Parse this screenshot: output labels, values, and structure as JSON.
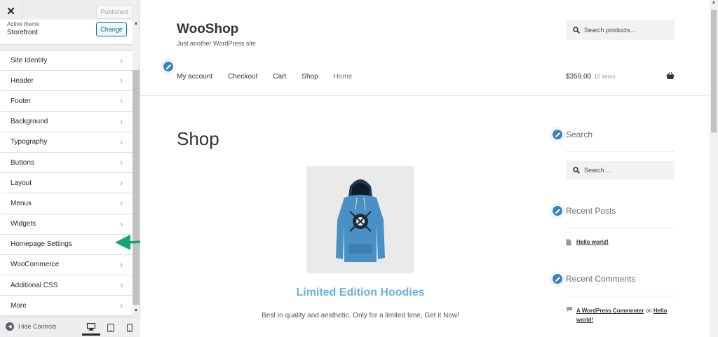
{
  "sidebar": {
    "close_label": "✕",
    "published_label": "Published",
    "theme_caption": "Active theme",
    "theme_name": "Storefront",
    "change_label": "Change",
    "items": [
      {
        "label": "Site Identity"
      },
      {
        "label": "Header"
      },
      {
        "label": "Footer"
      },
      {
        "label": "Background"
      },
      {
        "label": "Typography"
      },
      {
        "label": "Buttons"
      },
      {
        "label": "Layout"
      },
      {
        "label": "Menus"
      },
      {
        "label": "Widgets"
      },
      {
        "label": "Homepage Settings"
      },
      {
        "label": "WooCommerce"
      },
      {
        "label": "Additional CSS"
      },
      {
        "label": "More"
      }
    ],
    "hide_controls_label": "Hide Controls",
    "active_device": "desktop"
  },
  "preview": {
    "site_title": "WooShop",
    "site_description": "Just another WordPress site",
    "search_placeholder": "Search products…",
    "nav": [
      "My account",
      "Checkout",
      "Cart",
      "Shop",
      "Home"
    ],
    "cart_total": "$359.00",
    "cart_items": "12 items",
    "page_title": "Shop",
    "product_title": "Limited Edition Hoodies",
    "product_description": "Best in quality and aesthetic. Only for a limited time, Get it Now!",
    "widgets": {
      "search_title": "Search",
      "search_placeholder": "Search …",
      "recent_posts_title": "Recent Posts",
      "recent_post": "Hello world!",
      "recent_comments_title": "Recent Comments",
      "comment_author": "A WordPress Commenter",
      "comment_on": "on",
      "comment_post_part1": "Hello",
      "comment_post_part2": "world!"
    }
  },
  "colors": {
    "accent_blue": "#3582c4",
    "link_blue": "#67b3e0",
    "arrow_green": "#13a579"
  }
}
